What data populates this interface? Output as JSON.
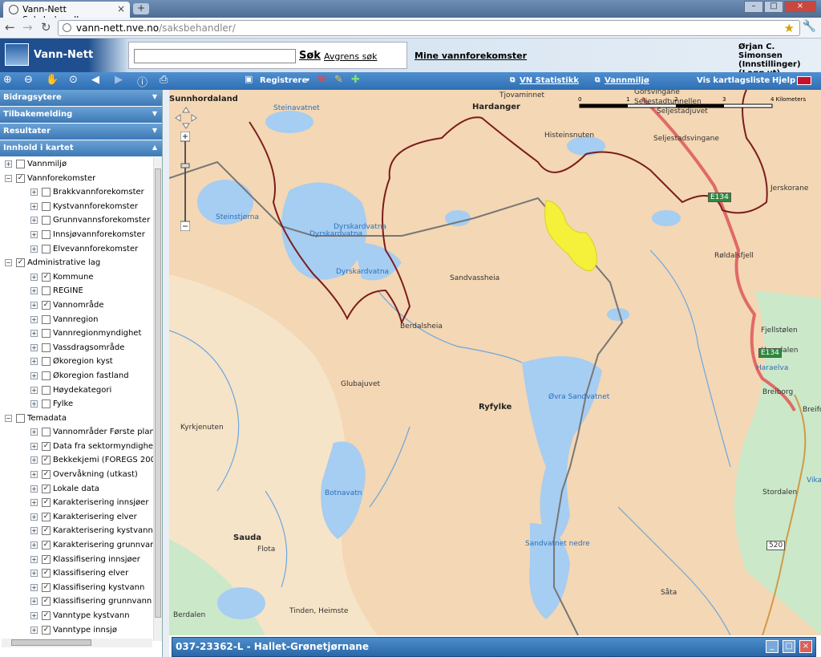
{
  "browser": {
    "tab_title": "Vann-Nett Saksbehandler",
    "url_host": "vann-nett.nve.no",
    "url_path": "/saksbehandler/"
  },
  "header": {
    "app_title": "Vann-Nett",
    "search_placeholder": "",
    "search_button": "Søk",
    "refine_search": "Avgrens søk",
    "my_waterbodies": "Mine vannforekomster",
    "user_name": "Ørjan C. Simonsen",
    "settings": "(Innstillinger)",
    "logout": "(Logg ut)"
  },
  "toolbar": {
    "register": "Registrere",
    "vn_stats": "VN Statistikk",
    "water_env": "Vannmiljø",
    "map_list": "Vis kartlagsliste",
    "help": "Hjelp"
  },
  "sidebar": {
    "panels": [
      "Bidragsytere",
      "Tilbakemelding",
      "Resultater",
      "Innhold i kartet"
    ],
    "tree": [
      {
        "label": "Vannmiljø",
        "level": 0,
        "checked": false,
        "expanded": false
      },
      {
        "label": "Vannforekomster",
        "level": 0,
        "checked": true,
        "expanded": true
      },
      {
        "label": "Brakkvannforekomster",
        "level": 1,
        "checked": false,
        "expanded": false
      },
      {
        "label": "Kystvannforekomster",
        "level": 1,
        "checked": false,
        "expanded": false
      },
      {
        "label": "Grunnvannsforekomster",
        "level": 1,
        "checked": false,
        "expanded": false
      },
      {
        "label": "Innsjøvannforekomster",
        "level": 1,
        "checked": false,
        "expanded": false
      },
      {
        "label": "Elvevannforekomster",
        "level": 1,
        "checked": false,
        "expanded": false
      },
      {
        "label": "Administrative lag",
        "level": 0,
        "checked": true,
        "expanded": true
      },
      {
        "label": "Kommune",
        "level": 1,
        "checked": true,
        "expanded": false
      },
      {
        "label": "REGINE",
        "level": 1,
        "checked": false,
        "expanded": false
      },
      {
        "label": "Vannområde",
        "level": 1,
        "checked": true,
        "expanded": false
      },
      {
        "label": "Vannregion",
        "level": 1,
        "checked": false,
        "expanded": false
      },
      {
        "label": "Vannregionmyndighet",
        "level": 1,
        "checked": false,
        "expanded": false
      },
      {
        "label": "Vassdragsområde",
        "level": 1,
        "checked": false,
        "expanded": false
      },
      {
        "label": "Økoregion kyst",
        "level": 1,
        "checked": false,
        "expanded": false
      },
      {
        "label": "Økoregion fastland",
        "level": 1,
        "checked": false,
        "expanded": false
      },
      {
        "label": "Høydekategori",
        "level": 1,
        "checked": false,
        "expanded": false
      },
      {
        "label": "Fylke",
        "level": 1,
        "checked": false,
        "expanded": false
      },
      {
        "label": "Temadata",
        "level": 0,
        "checked": false,
        "expanded": true
      },
      {
        "label": "Vannområder Første planfa",
        "level": 1,
        "checked": false,
        "expanded": false
      },
      {
        "label": "Data fra sektormyndighete",
        "level": 1,
        "checked": true,
        "expanded": false
      },
      {
        "label": "Bekkekjemi (FOREGS 2008",
        "level": 1,
        "checked": true,
        "expanded": false
      },
      {
        "label": "Overvåkning (utkast)",
        "level": 1,
        "checked": true,
        "expanded": false
      },
      {
        "label": "Lokale data",
        "level": 1,
        "checked": true,
        "expanded": false
      },
      {
        "label": "Karakterisering innsjøer",
        "level": 1,
        "checked": true,
        "expanded": false
      },
      {
        "label": "Karakterisering elver",
        "level": 1,
        "checked": true,
        "expanded": false
      },
      {
        "label": "Karakterisering kystvann",
        "level": 1,
        "checked": true,
        "expanded": false
      },
      {
        "label": "Karakterisering grunnvann",
        "level": 1,
        "checked": true,
        "expanded": false
      },
      {
        "label": "Klassifisering innsjøer",
        "level": 1,
        "checked": true,
        "expanded": false
      },
      {
        "label": "Klassifisering elver",
        "level": 1,
        "checked": true,
        "expanded": false
      },
      {
        "label": "Klassifisering kystvann",
        "level": 1,
        "checked": true,
        "expanded": false
      },
      {
        "label": "Klassifisering grunnvann",
        "level": 1,
        "checked": true,
        "expanded": false
      },
      {
        "label": "Vanntype kystvann",
        "level": 1,
        "checked": true,
        "expanded": false
      },
      {
        "label": "Vanntype innsjø",
        "level": 1,
        "checked": true,
        "expanded": false
      }
    ]
  },
  "map": {
    "scale_unit": "4 Kilometers",
    "scale_ticks": [
      "0",
      "1",
      "2",
      "3"
    ],
    "places": [
      {
        "name": "Sunnhordaland",
        "type": "region"
      },
      {
        "name": "Hardanger",
        "type": "region"
      },
      {
        "name": "Tjovaminnet",
        "type": "place"
      },
      {
        "name": "Gorsvingane",
        "type": "place"
      },
      {
        "name": "Seljestadtunnellen",
        "type": "place"
      },
      {
        "name": "Seljestadjuvet",
        "type": "place"
      },
      {
        "name": "Seljestadsvingane",
        "type": "place"
      },
      {
        "name": "Histeinsnuten",
        "type": "place"
      },
      {
        "name": "Jerskorane",
        "type": "place"
      },
      {
        "name": "Steinavatnet",
        "type": "water"
      },
      {
        "name": "Steinstjørna",
        "type": "water"
      },
      {
        "name": "Dyrskardvatna",
        "type": "water"
      },
      {
        "name": "Dyrskardvatna",
        "type": "water"
      },
      {
        "name": "Dyrskardvatna",
        "type": "water"
      },
      {
        "name": "Sandvassheia",
        "type": "place"
      },
      {
        "name": "Røldalsfjell",
        "type": "place"
      },
      {
        "name": "Berdalsheia",
        "type": "place"
      },
      {
        "name": "Fjellstølen",
        "type": "place"
      },
      {
        "name": "Haradalen",
        "type": "place"
      },
      {
        "name": "Haraelva",
        "type": "water"
      },
      {
        "name": "Breiborg",
        "type": "place"
      },
      {
        "name": "Breifo",
        "type": "place"
      },
      {
        "name": "Glubajuvet",
        "type": "place"
      },
      {
        "name": "Ryfylke",
        "type": "region"
      },
      {
        "name": "Øvra Sandvatnet",
        "type": "water"
      },
      {
        "name": "Kyrkjenuten",
        "type": "place"
      },
      {
        "name": "Stordalen",
        "type": "place"
      },
      {
        "name": "Vika",
        "type": "water"
      },
      {
        "name": "Botnavatn",
        "type": "water"
      },
      {
        "name": "Sauda",
        "type": "region"
      },
      {
        "name": "Flota",
        "type": "place"
      },
      {
        "name": "Sandvatnet nedre",
        "type": "water"
      },
      {
        "name": "Såta",
        "type": "place"
      },
      {
        "name": "Tinden, Heimste",
        "type": "place"
      },
      {
        "name": "Berdalen",
        "type": "place"
      }
    ],
    "roads": [
      "E134",
      "E134",
      "520"
    ],
    "selection_color": "#f5f13a",
    "boundary_color": "#7a1d1d",
    "water_color": "#a6cdf2"
  },
  "bottom_panel": {
    "title": "037-23362-L - Hallet-Grønetjørnane"
  }
}
